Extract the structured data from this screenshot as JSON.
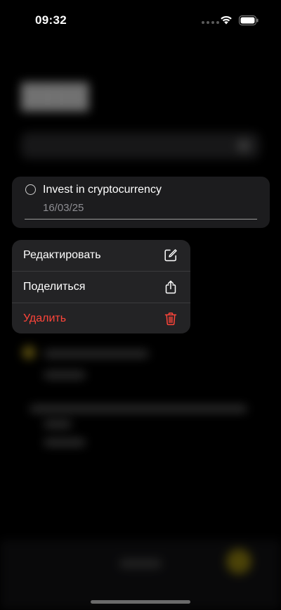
{
  "status_bar": {
    "time": "09:32"
  },
  "task": {
    "title": "Invest in cryptocurrency",
    "date": "16/03/25"
  },
  "context_menu": {
    "items": [
      {
        "label": "Редактировать",
        "icon": "edit-icon",
        "destructive": false
      },
      {
        "label": "Поделиться",
        "icon": "share-icon",
        "destructive": false
      },
      {
        "label": "Удалить",
        "icon": "trash-icon",
        "destructive": true
      }
    ]
  },
  "colors": {
    "background": "#000000",
    "card": "#1c1c1e",
    "menu": "#232325",
    "destructive": "#ff453a",
    "secondary_text": "#8e8e93"
  }
}
